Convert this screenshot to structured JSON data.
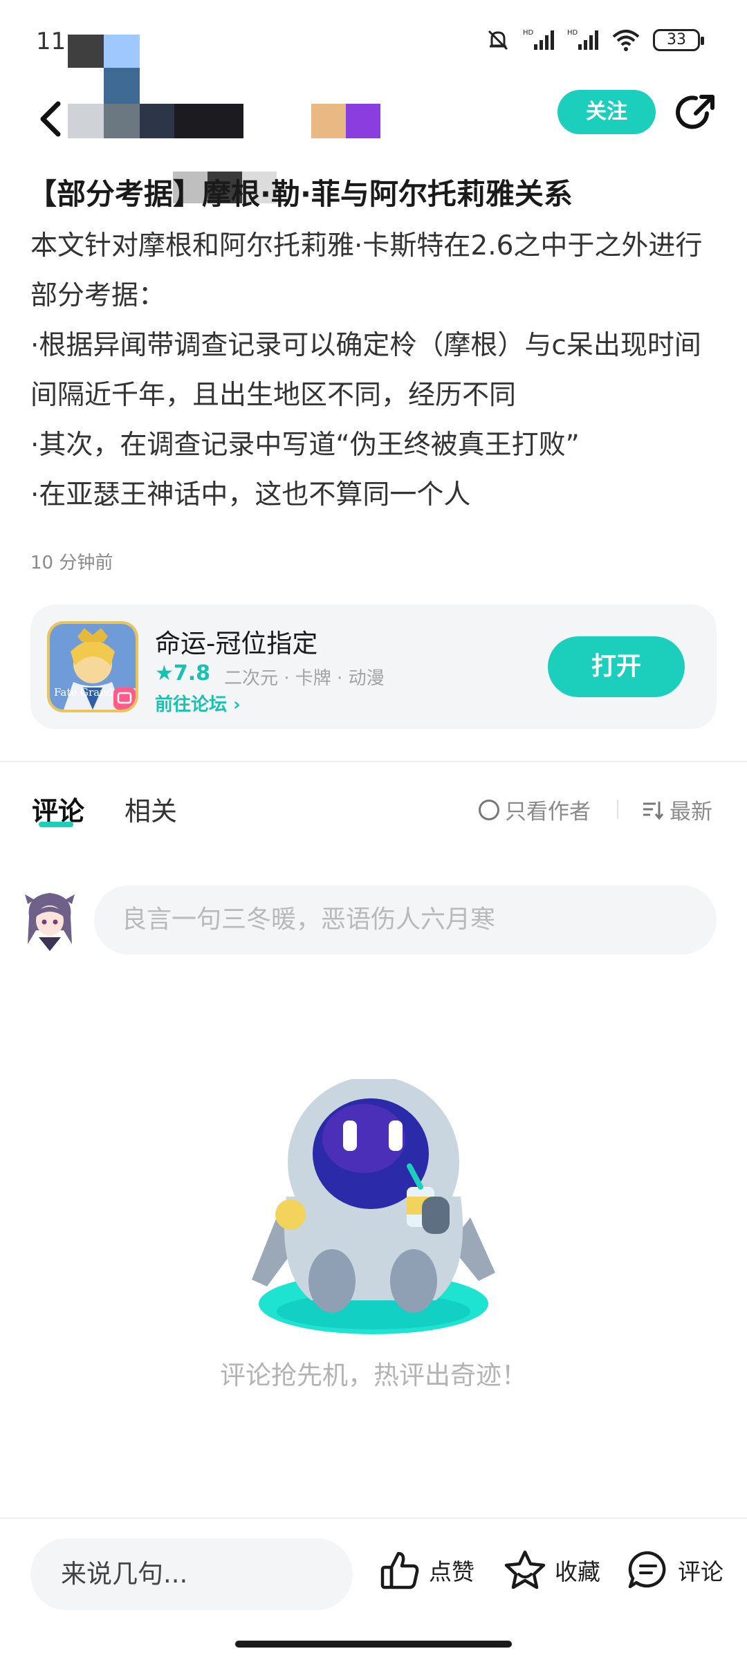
{
  "status_bar": {
    "time": "11:",
    "battery": "33"
  },
  "header": {
    "follow_label": "关注"
  },
  "article": {
    "title": "【部分考据】摩根·勒·菲与阿尔托莉雅关系",
    "paragraphs": [
      "本文针对摩根和阿尔托莉雅·卡斯特在2.6之中于之外进行部分考据：",
      "·根据异闻带调查记录可以确定柃（摩根）与c呆出现时间间隔近千年，且出生地区不同，经历不同",
      "·其次，在调查记录中写道“伪王终被真王打败”",
      "·在亚瑟王神话中，这也不算同一个人"
    ],
    "time": "10 分钟前"
  },
  "app_card": {
    "name": "命运-冠位指定",
    "rating": "★7.8",
    "tags": "二次元 · 卡牌 · 动漫",
    "forum_link": "前往论坛 ›",
    "open_label": "打开",
    "icon_text": "Fate Grand Order"
  },
  "tabs": {
    "comment": "评论",
    "related": "相关",
    "author_only": "只看作者",
    "latest": "最新"
  },
  "comment_box": {
    "placeholder": "良言一句三冬暖，恶语伤人六月寒"
  },
  "empty_state": {
    "text": "评论抢先机，热评出奇迹！"
  },
  "bottom_bar": {
    "input_placeholder": "来说几句...",
    "like_label": "点赞",
    "favorite_label": "收藏",
    "comment_label": "评论"
  },
  "colors": {
    "accent": "#1ccfbd",
    "muted": "#8a8a8a"
  }
}
